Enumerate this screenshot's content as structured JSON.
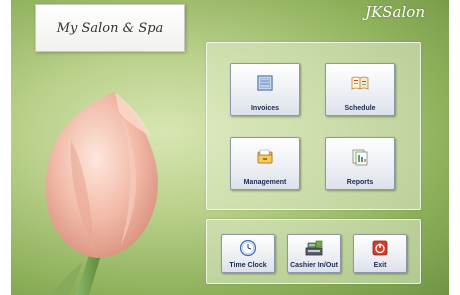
{
  "app": {
    "title": "My Salon & Spa",
    "brand": "JKSalon"
  },
  "main_panel": {
    "buttons": [
      {
        "label": "Invoices",
        "icon": "invoice-icon"
      },
      {
        "label": "Schedule",
        "icon": "schedule-book-icon"
      },
      {
        "label": "Management",
        "icon": "management-folder-icon"
      },
      {
        "label": "Reports",
        "icon": "reports-icon"
      }
    ]
  },
  "bottom_panel": {
    "buttons": [
      {
        "label": "Time Clock",
        "icon": "clock-icon"
      },
      {
        "label": "Cashier In/Out",
        "icon": "cash-register-icon"
      },
      {
        "label": "Exit",
        "icon": "exit-icon"
      }
    ]
  },
  "colors": {
    "background_green": "#a6c275",
    "tulip_pink": "#f0b7a6",
    "button_text": "#1d2b4f",
    "exit_red": "#d93b2b"
  }
}
